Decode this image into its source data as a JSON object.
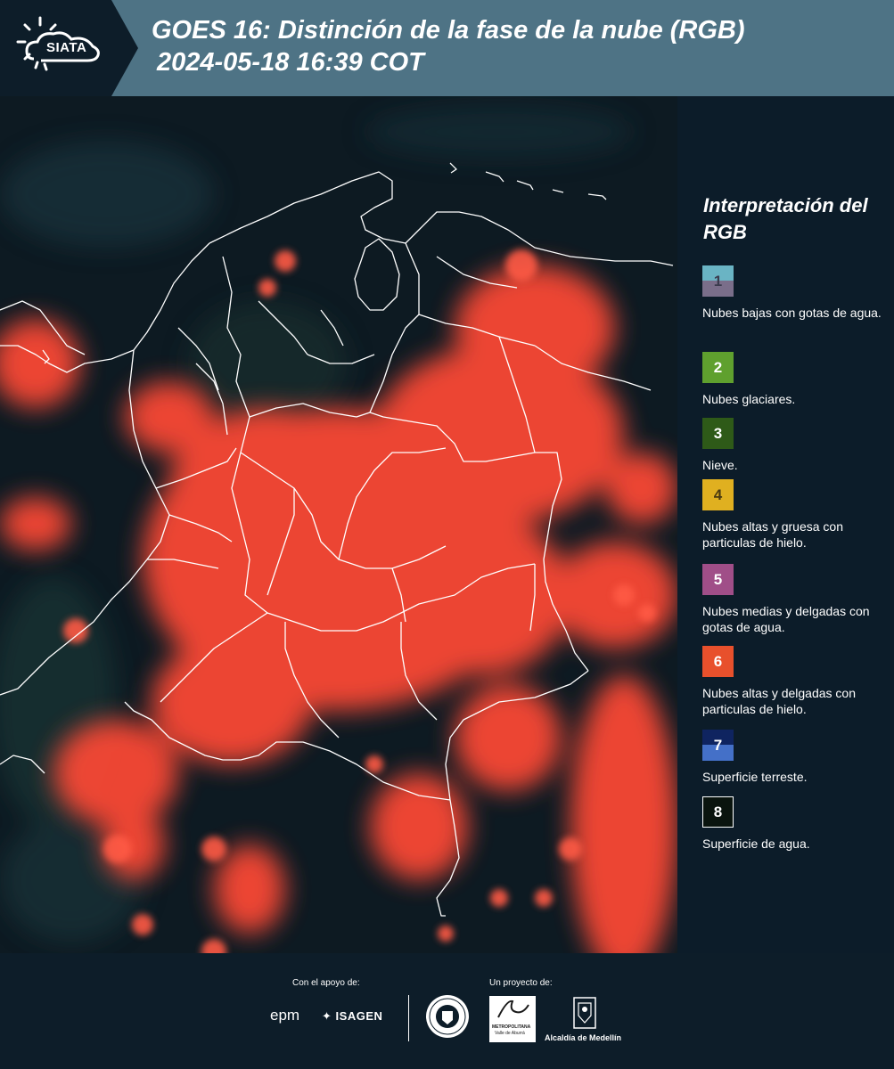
{
  "header": {
    "logo_text": "SIATA",
    "title_line1": "GOES 16: Distinción de la fase de la nube (RGB)",
    "title_line2": "2024-05-18 16:39 COT"
  },
  "legend": {
    "title": "Interpretación del RGB",
    "items": [
      {
        "number": "1",
        "top_color": "#6ab4c4",
        "bottom_color": "#7a6e8a",
        "description": "Nubes bajas con gotas de agua."
      },
      {
        "number": "2",
        "top_color": "#5fa02e",
        "bottom_color": "#5fa02e",
        "description": "Nubes glaciares."
      },
      {
        "number": "3",
        "top_color": "#2e5a18",
        "bottom_color": "#2e5a18",
        "description": "Nieve."
      },
      {
        "number": "4",
        "top_color": "#e0b020",
        "bottom_color": "#e0b020",
        "description": "Nubes altas y gruesa con particulas de hielo."
      },
      {
        "number": "5",
        "top_color": "#a04e88",
        "bottom_color": "#a04e88",
        "description": "Nubes medias y delgadas con gotas de agua."
      },
      {
        "number": "6",
        "top_color": "#e8502c",
        "bottom_color": "#e8502c",
        "description": "Nubes altas y delgadas con particulas de hielo."
      },
      {
        "number": "7",
        "top_color": "#0f2460",
        "bottom_color": "#4470c8",
        "description": "Superficie terreste."
      },
      {
        "number": "8",
        "top_color": "#0a140e",
        "bottom_color": "#0a140e",
        "description": "Superficie de agua."
      }
    ]
  },
  "footer": {
    "support_label": "Con el apoyo de:",
    "project_label": "Un proyecto de:",
    "epm": "epm",
    "isagen": "ISAGEN",
    "amva_line1": "METROPOLITANA",
    "amva_line2": "Valle de Aburrá",
    "alcaldia": "Alcaldía de Medellín"
  },
  "colors": {
    "header_bg": "#4e7385",
    "logo_bg": "#0d1d29",
    "legend_bg": "#0c1c29",
    "cloud_ice": "#ff4a35",
    "map_bg": "#0d1a22"
  }
}
